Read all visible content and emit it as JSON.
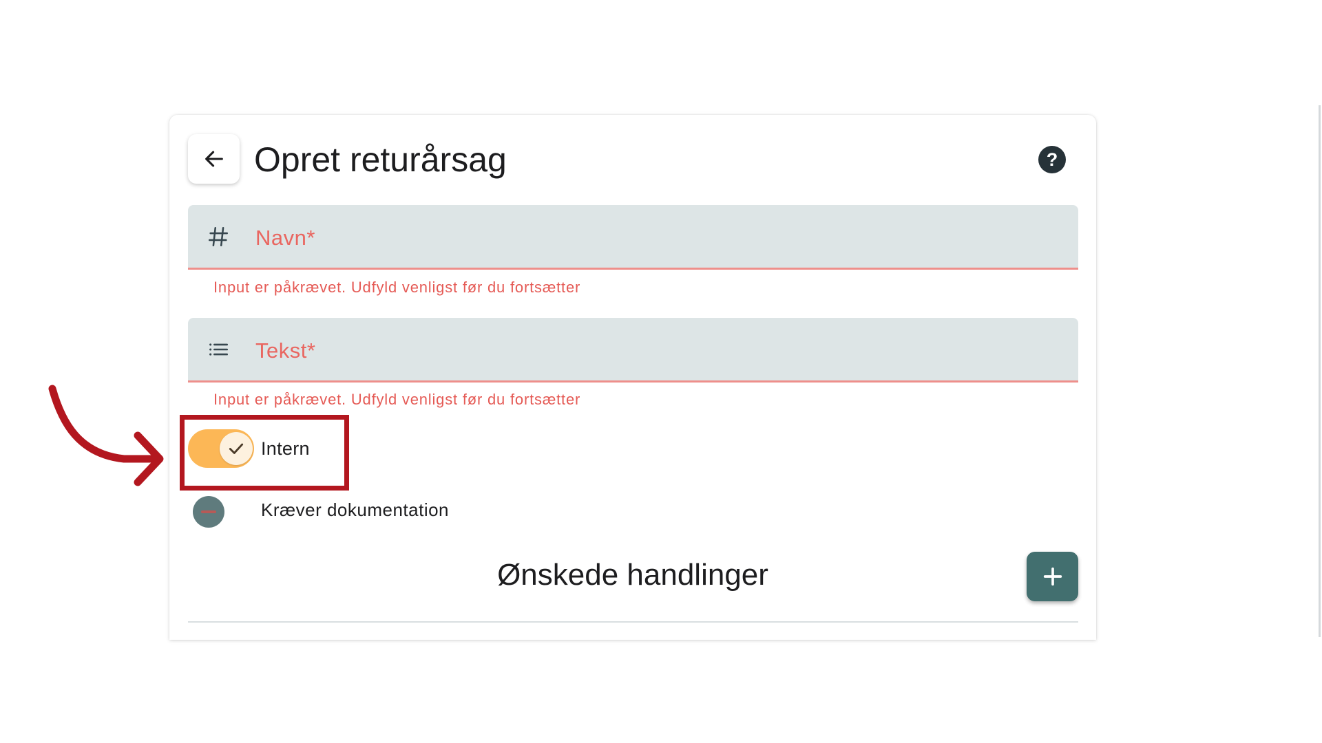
{
  "header": {
    "title": "Opret returårsag",
    "help_glyph": "?"
  },
  "fields": [
    {
      "icon": "hash-icon",
      "icon_glyph": "#",
      "label": "Navn*",
      "error": "Input er påkrævet. Udfyld venligst før du fortsætter"
    },
    {
      "icon": "list-icon",
      "label": "Tekst*",
      "error": "Input er påkrævet. Udfyld venligst før du fortsætter"
    }
  ],
  "toggles": {
    "intern": {
      "label": "Intern",
      "checked": true
    },
    "documentation": {
      "label": "Kræver dokumentation",
      "state": "indeterminate"
    }
  },
  "actions": {
    "title": "Ønskede handlinger",
    "add_glyph": "+"
  },
  "colors": {
    "field_background": "#dde5e6",
    "error_red": "#e55a55",
    "toggle_on": "#fcb756",
    "add_button": "#426f6f",
    "annotation_red": "#b3171f",
    "help_button": "#263238"
  }
}
